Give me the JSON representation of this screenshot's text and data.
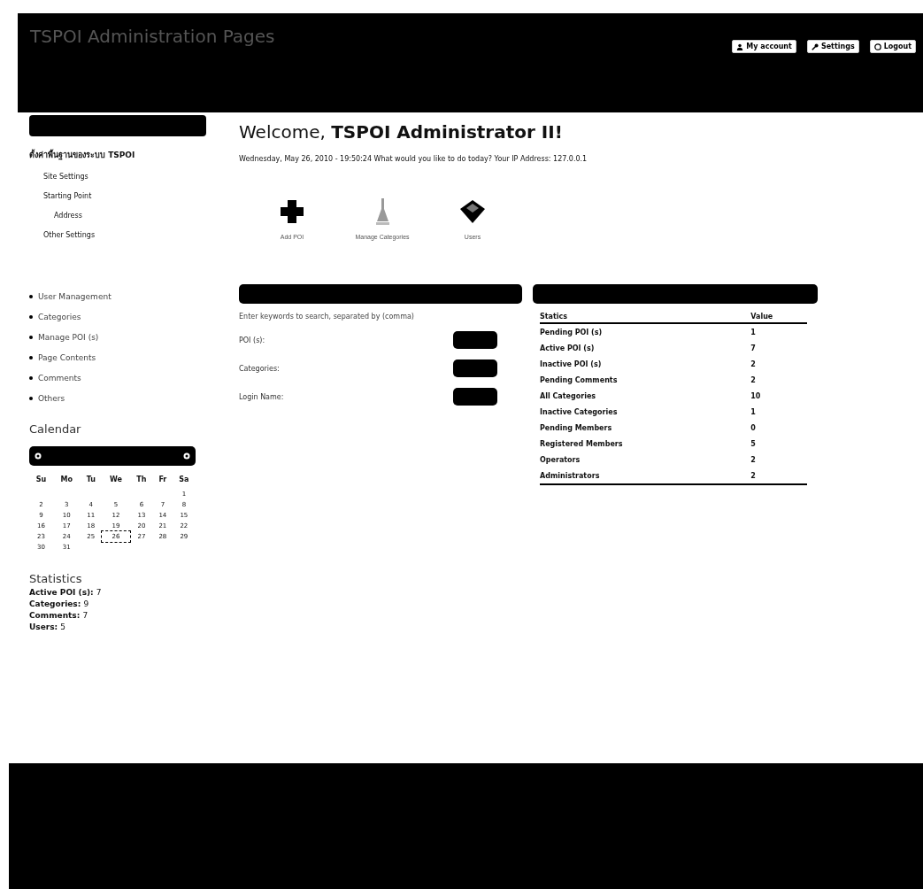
{
  "header": {
    "title": "TSPOI Administration Pages",
    "buttons": [
      {
        "kind": "account",
        "label": "My account"
      },
      {
        "kind": "settings",
        "label": "Settings"
      },
      {
        "kind": "logout",
        "label": "Logout"
      }
    ]
  },
  "sidebar": {
    "settings_title": "ตั้งค่าพื้นฐานของระบบ TSPOI",
    "settings_items": [
      {
        "label": "Site Settings"
      },
      {
        "label": "Starting Point",
        "children": [
          {
            "label": "Address"
          }
        ]
      },
      {
        "label": "Other Settings"
      }
    ],
    "menu": [
      "User Management",
      "Categories",
      "Manage POI (s)",
      "Page Contents",
      "Comments",
      "Others"
    ],
    "calendar": {
      "title": "Calendar",
      "weekdays": [
        "Su",
        "Mo",
        "Tu",
        "We",
        "Th",
        "Fr",
        "Sa"
      ],
      "weeks": [
        {
          "kind": "first",
          "days": [
            {
              "day": "1",
              "today": false
            }
          ]
        },
        {
          "kind": "full",
          "days": [
            {
              "day": "2",
              "today": false
            },
            {
              "day": "3",
              "today": false
            },
            {
              "day": "4",
              "today": false
            },
            {
              "day": "5",
              "today": false
            },
            {
              "day": "6",
              "today": false
            },
            {
              "day": "7",
              "today": false
            },
            {
              "day": "8",
              "today": false
            }
          ]
        },
        {
          "kind": "full",
          "days": [
            {
              "day": "9",
              "today": false
            },
            {
              "day": "10",
              "today": false
            },
            {
              "day": "11",
              "today": false
            },
            {
              "day": "12",
              "today": false
            },
            {
              "day": "13",
              "today": false
            },
            {
              "day": "14",
              "today": false
            },
            {
              "day": "15",
              "today": false
            }
          ]
        },
        {
          "kind": "full",
          "days": [
            {
              "day": "16",
              "today": false
            },
            {
              "day": "17",
              "today": false
            },
            {
              "day": "18",
              "today": false
            },
            {
              "day": "19",
              "today": false
            },
            {
              "day": "20",
              "today": false
            },
            {
              "day": "21",
              "today": false
            },
            {
              "day": "22",
              "today": false
            }
          ]
        },
        {
          "kind": "full",
          "days": [
            {
              "day": "23",
              "today": false
            },
            {
              "day": "24",
              "today": false
            },
            {
              "day": "25",
              "today": false
            },
            {
              "day": "26",
              "today": true
            },
            {
              "day": "27",
              "today": false
            },
            {
              "day": "28",
              "today": false
            },
            {
              "day": "29",
              "today": false
            }
          ]
        },
        {
          "kind": "last",
          "days": [
            {
              "day": "30",
              "today": false
            },
            {
              "day": "31",
              "today": false
            }
          ]
        }
      ]
    },
    "statistics": {
      "title": "Statistics",
      "items": [
        {
          "label": "Active POI (s):",
          "value": "7"
        },
        {
          "label": "Categories:",
          "value": "9"
        },
        {
          "label": "Comments:",
          "value": "7"
        },
        {
          "label": "Users:",
          "value": "5"
        }
      ]
    }
  },
  "main": {
    "welcome": "Welcome, **TSPOI Administrator II!**",
    "subtitle": "Wednesday, May 26, 2010 - 19:50:24 What would you like to do today? Your IP Address: 127.0.0.1",
    "shortcuts": [
      {
        "kind": "add",
        "label": "Add POI"
      },
      {
        "kind": "categories",
        "label": "Manage Categories"
      },
      {
        "kind": "users",
        "label": "Users"
      }
    ],
    "search": {
      "hint": "Enter keywords to search, separated by (comma)",
      "fields": [
        "POI (s):",
        "Categories:",
        "Login Name:"
      ]
    },
    "stats_table": {
      "columns": [
        "Statics",
        "Value"
      ],
      "rows": [
        [
          "Pending POI (s)",
          "1"
        ],
        [
          "Active POI (s)",
          "7"
        ],
        [
          "Inactive POI (s)",
          "2"
        ],
        [
          "Pending Comments",
          "2"
        ],
        [
          "All Categories",
          "10"
        ],
        [
          "Inactive Categories",
          "1"
        ],
        [
          "Pending Members",
          "0"
        ],
        [
          "Registered Members",
          "5"
        ],
        [
          "Operators",
          "2"
        ],
        [
          "Administrators",
          "2"
        ]
      ]
    }
  }
}
